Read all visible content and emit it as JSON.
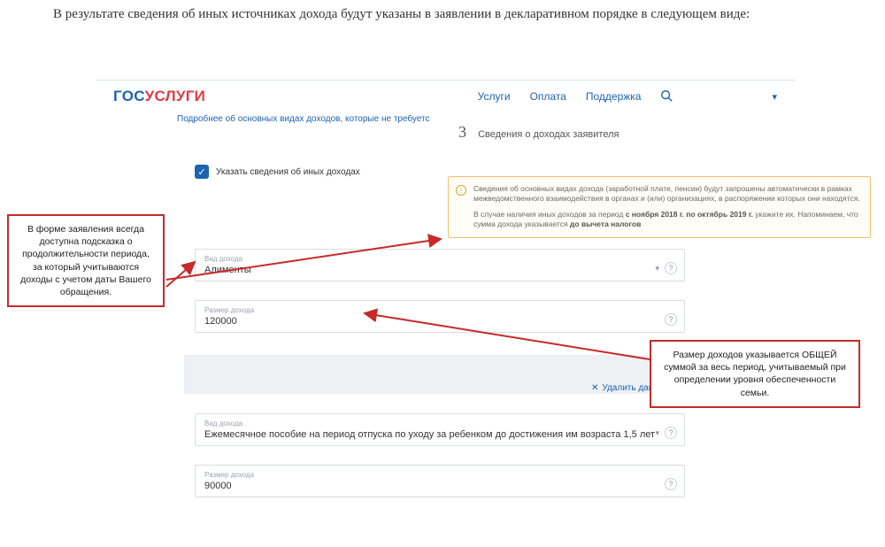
{
  "docIntro": "В результате сведения об иных источниках дохода будут указаны в заявлении в декларативном порядке в следующем виде:",
  "logo": {
    "part1": "ГОС",
    "part2": "УСЛУГИ"
  },
  "nav": {
    "services": "Услуги",
    "payment": "Оплата",
    "support": "Поддержка"
  },
  "linkAbout": "Подробнее об основных видах доходов, которые не требуетс",
  "section": {
    "num": "3",
    "title": "Сведения о доходах заявителя"
  },
  "checkboxLabel": "Указать сведения об иных доходах",
  "info": {
    "p1": "Сведения об основных видах дохода (заработной плате, пенсии) будут запрошены автоматически в рамках межведомственного взаимодействия в органах и (или) организациях, в распоряжении которых они находятся.",
    "p2a": "В случае наличия иных доходов за период ",
    "p2b": "с ноября 2018 г. по октябрь 2019 г.",
    "p2c": " укажите их. Напоминаем, что сумма дохода указывается ",
    "p2d": "до вычета налогов"
  },
  "fields": {
    "typeLabel": "Вид дохода",
    "amountLabel": "Размер дохода",
    "type1": "Алименты",
    "amount1": "120000",
    "type2": "Ежемесячное пособие на период отпуска по уходу за ребенком до достижения им возраста 1,5 лет",
    "amount2": "90000"
  },
  "deleteLabel": "Удалить данные",
  "callout1": "В форме заявления всегда доступна подсказка о продолжительности периода, за который учитываются доходы с учетом даты Вашего обращения.",
  "callout2": "Размер доходов указывается ОБЩЕЙ суммой за весь период, учитываемый при определении уровня обеспеченности семьи."
}
